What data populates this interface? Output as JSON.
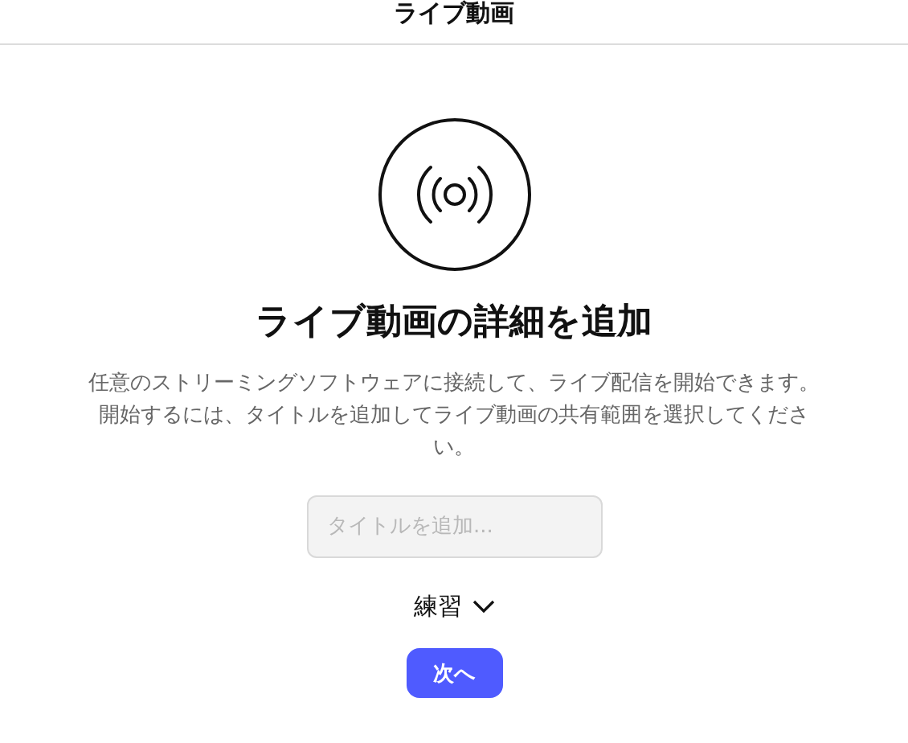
{
  "header": {
    "title": "ライブ動画"
  },
  "heading": "ライブ動画の詳細を追加",
  "description": "任意のストリーミングソフトウェアに接続して、ライブ配信を開始できます。開始するには、タイトルを追加してライブ動画の共有範囲を選択してください。",
  "title_field": {
    "placeholder": "タイトルを追加..."
  },
  "audience": {
    "label": "練習"
  },
  "next_button": "次へ"
}
